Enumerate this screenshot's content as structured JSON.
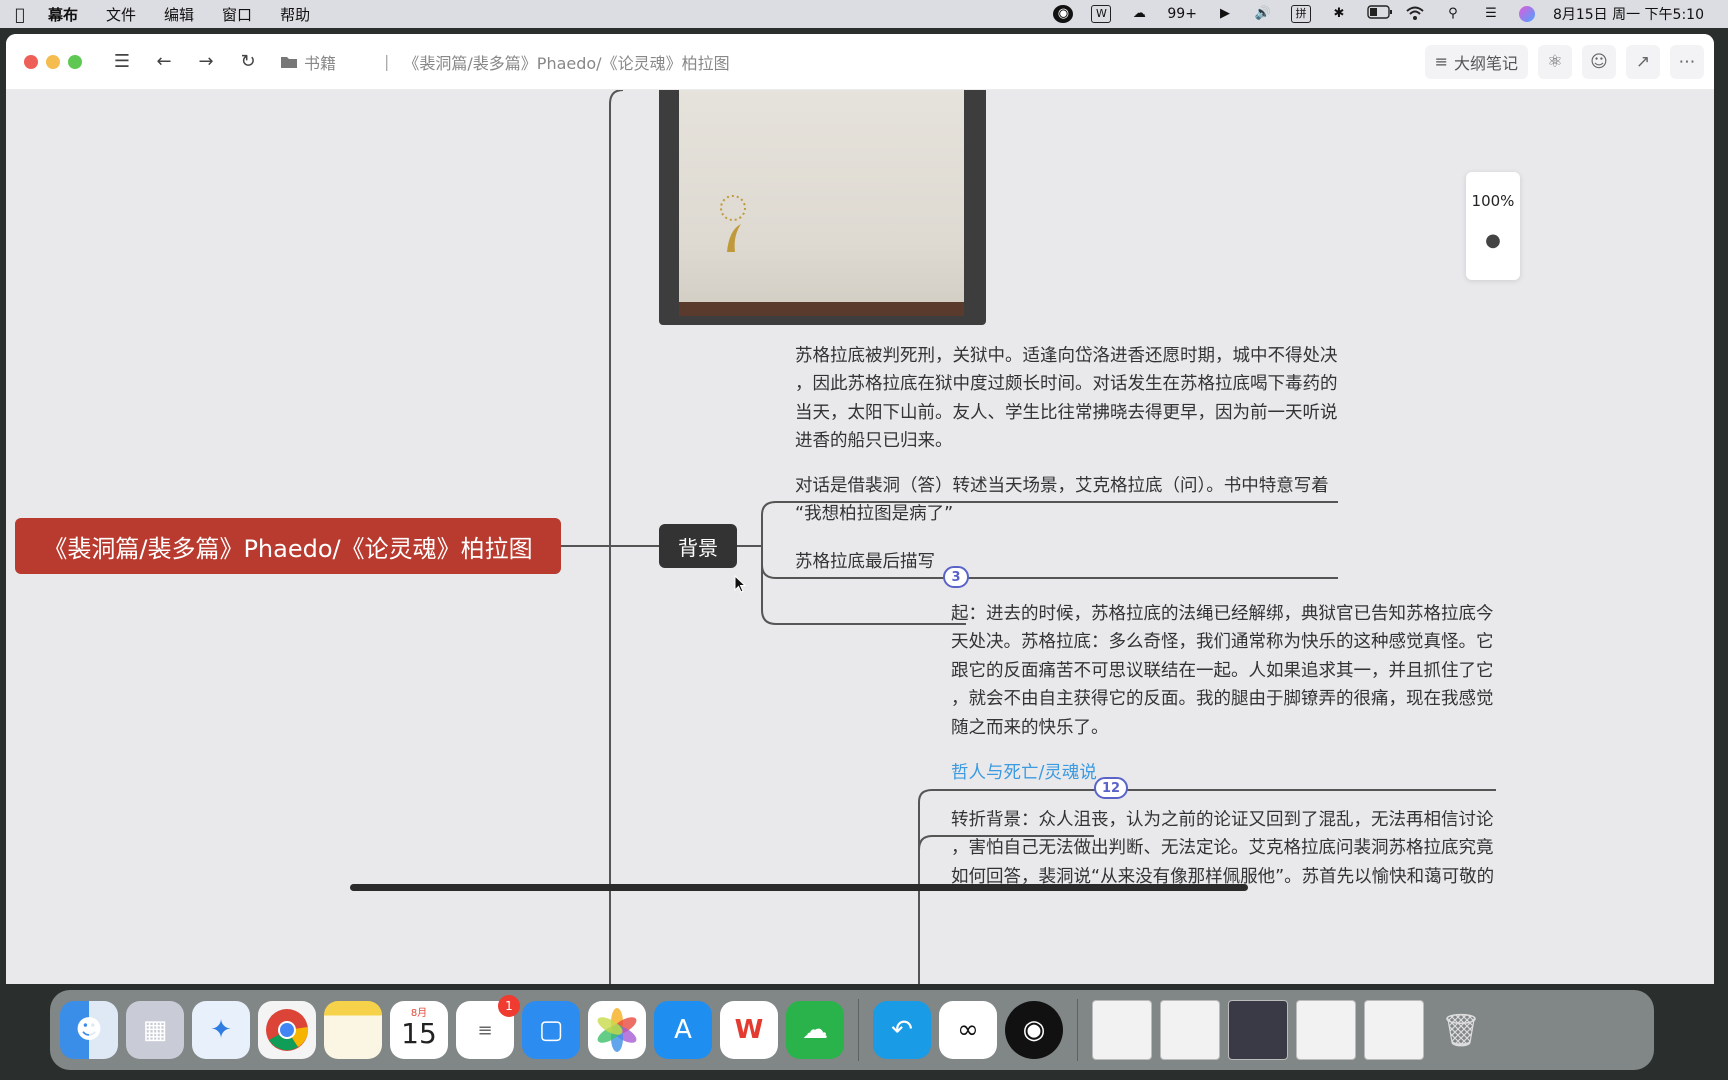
{
  "menubar": {
    "app_name": "幕布",
    "menus": [
      "文件",
      "编辑",
      "窗口",
      "帮助"
    ],
    "notification_count": "99+",
    "input_method": "拼",
    "datetime": "8月15日 周一 下午5:10"
  },
  "titlebar": {
    "folder": "书籍",
    "doc_title": "《裴洞篇/裴多篇》Phaedo/《论灵魂》柏拉图",
    "outline_button": "大纲笔记"
  },
  "mindmap": {
    "root": "《裴洞篇/裴多篇》Phaedo/《论灵魂》柏拉图",
    "main_node": "背景",
    "background_text_lines": [
      "苏格拉底被判死刑，关狱中。适逢向岱洛进香还愿时期，城中不得处决",
      "，因此苏格拉底在狱中度过颇长时间。对话发生在苏格拉底喝下毒药的",
      "当天，太阳下山前。友人、学生比往常拂晓去得更早，因为前一天听说",
      "进香的船只已归来。"
    ],
    "dialogue_text_lines": [
      "对话是借裴洞（答）转述当天场景，艾克格拉底（问）。书中特意写着",
      "“我想柏拉图是病了”"
    ],
    "last_scene_label": "苏格拉底最后描写",
    "last_scene_badge": "3",
    "beginning_text_lines": [
      "起：进去的时候，苏格拉底的法绳已经解绑，典狱官已告知苏格拉底今",
      "天处决。苏格拉底：多么奇怪，我们通常称为快乐的这种感觉真怪。它",
      "跟它的反面痛苦不可思议联结在一起。人如果追求其一，并且抓住了它",
      "，就会不由自主获得它的反面。我的腿由于脚镣弄的很痛，现在我感觉",
      "随之而来的快乐了。"
    ],
    "philosopher_link": "哲人与死亡/灵魂说",
    "philosopher_badge": "12",
    "turning_text_lines": [
      "转折背景：众人沮丧，认为之前的论证又回到了混乱，无法再相信讨论",
      "，害怕自己无法做出判断、无法定论。艾克格拉底问裴洞苏格拉底究竟",
      "如何回答，裴洞说“从来没有像那样佩服他”。苏首先以愉快和蔼可敬的"
    ]
  },
  "zoom": {
    "level": "100%"
  },
  "dock": {
    "calendar_month": "8月",
    "calendar_day": "15",
    "reminders_badge": "1"
  },
  "colors": {
    "root_node": "#b93a2e",
    "main_node": "#333333",
    "link": "#3b9ae0",
    "badge": "#5a63c8"
  }
}
